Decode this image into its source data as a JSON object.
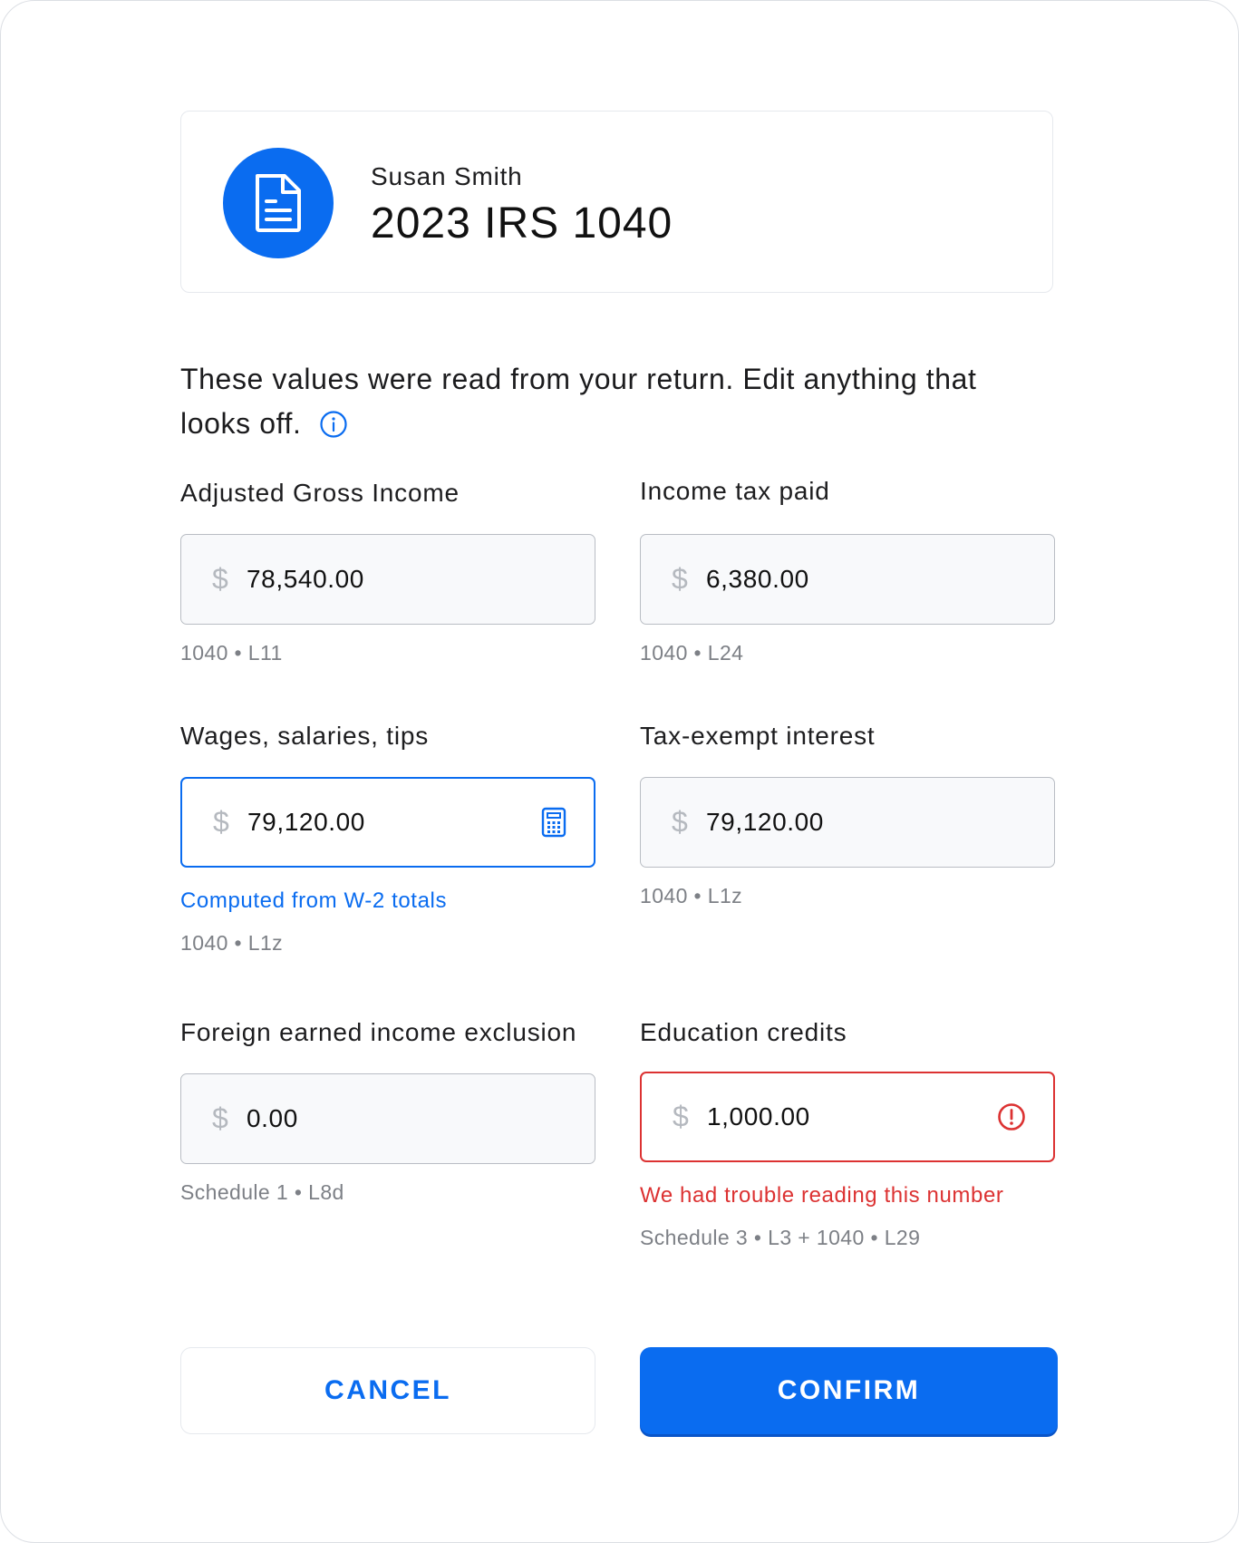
{
  "header": {
    "name": "Susan Smith",
    "title": "2023 IRS 1040",
    "icon": "document-icon"
  },
  "intro": {
    "text": "These values were read from your return. Edit anything that looks off.",
    "icon": "info-icon"
  },
  "currency_symbol": "$",
  "fields": {
    "agi": {
      "label": "Adjusted Gross Income",
      "value": "78,540.00",
      "source": "1040 • L11"
    },
    "income_tax": {
      "label": "Income tax paid",
      "value": "6,380.00",
      "source": "1040 • L24"
    },
    "wages": {
      "label": "Wages, salaries, tips",
      "value": "79,120.00",
      "hint": "Computed from W-2 totals",
      "source": "1040 • L1z",
      "icon": "calculator-icon"
    },
    "tax_exempt": {
      "label": "Tax-exempt interest",
      "value": "79,120.00",
      "source": "1040 • L1z"
    },
    "foreign": {
      "label": "Foreign earned income exclusion",
      "value": "0.00",
      "source": "Schedule 1 • L8d"
    },
    "education": {
      "label": "Education credits",
      "value": "1,000.00",
      "error": "We had trouble reading this number",
      "source": "Schedule 3 • L3 + 1040 • L29",
      "icon": "alert-circle-icon"
    }
  },
  "buttons": {
    "cancel": "CANCEL",
    "confirm": "CONFIRM"
  },
  "colors": {
    "accent": "#0a6cf0",
    "error": "#dc3232",
    "muted": "#7d8086"
  }
}
